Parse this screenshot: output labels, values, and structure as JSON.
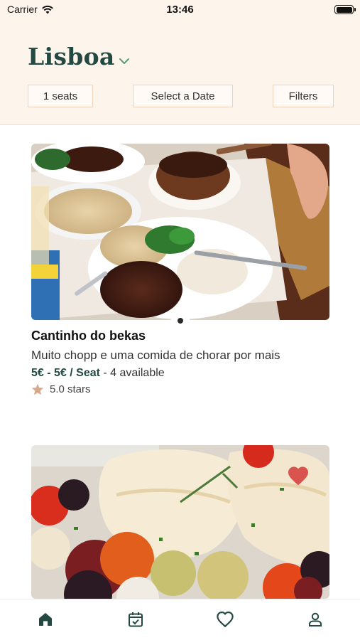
{
  "status_bar": {
    "carrier": "Carrier",
    "time": "13:46",
    "icons": [
      "wifi-icon",
      "battery-icon"
    ]
  },
  "header": {
    "city": "Lisboa",
    "city_chevron_icon": "chevron-down-icon",
    "seats_button": "1 seats",
    "date_button": "Select a Date",
    "filters_button": "Filters"
  },
  "listings": [
    {
      "name": "Cantinho do bekas",
      "description": "Muito chopp e uma comida de chorar por mais",
      "price": "5€ - 5€ / Seat",
      "availability": " - 4 available",
      "rating": "5.0 stars",
      "rating_icon": "star-icon",
      "photo": "feijoada-dinner-photo"
    },
    {
      "photo": "bacalhau-with-vegetables-photo",
      "favorite": true,
      "favorite_icon": "heart-icon"
    }
  ],
  "tab_bar": {
    "tabs": [
      "home-icon",
      "calendar-icon",
      "heart-outline-icon",
      "person-icon"
    ],
    "active": "home"
  },
  "colors": {
    "brand": "#244942",
    "header_bg": "#fdf4ec",
    "button_border": "#f2d2b6",
    "star": "#d7a88a",
    "heart": "#d9534f"
  }
}
